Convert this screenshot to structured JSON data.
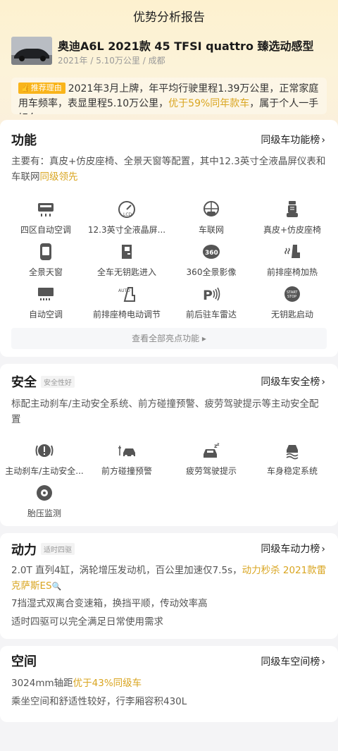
{
  "page_title": "优势分析报告",
  "car": {
    "name": "奥迪A6L 2021款 45 TFSI quattro 臻选动感型",
    "meta": "2021年 / 5.10万公里 / 成都"
  },
  "reason": {
    "tag": "推荐理由",
    "text_1": "2021年3月上牌，年平均行驶里程1.39万公里，正常家庭用车频率，表显里程5.10万公里，",
    "highlight": "优于59%同年款车",
    "text_2": "，属于个人一手好车"
  },
  "features": {
    "title": "功能",
    "link": "同级车功能榜",
    "desc_1": "主要有：真皮+仿皮座椅、全景天窗等配置，其中12.3英寸全液晶屏仪表和车联网",
    "desc_highlight": "同级领先",
    "items": [
      {
        "label": "四区自动空调",
        "icon": "climate-4zone-icon"
      },
      {
        "label": "12.3英寸全液晶屏...",
        "icon": "lcd-gauge-icon"
      },
      {
        "label": "车联网",
        "icon": "connected-car-icon"
      },
      {
        "label": "真皮+仿皮座椅",
        "icon": "leather-seat-icon"
      },
      {
        "label": "全景天窗",
        "icon": "panoramic-sunroof-icon"
      },
      {
        "label": "全车无钥匙进入",
        "icon": "keyless-entry-icon"
      },
      {
        "label": "360全景影像",
        "icon": "camera-360-icon"
      },
      {
        "label": "前排座椅加热",
        "icon": "seat-heating-icon"
      },
      {
        "label": "自动空调",
        "icon": "auto-ac-icon"
      },
      {
        "label": "前排座椅电动调节",
        "icon": "power-seat-icon"
      },
      {
        "label": "前后驻车雷达",
        "icon": "parking-radar-icon"
      },
      {
        "label": "无钥匙启动",
        "icon": "keyless-start-icon"
      }
    ],
    "all_button": "查看全部亮点功能 ▸"
  },
  "safety": {
    "title": "安全",
    "badge": "安全性好",
    "link": "同级车安全榜",
    "desc": "标配主动刹车/主动安全系统、前方碰撞预警、疲劳驾驶提示等主动安全配置",
    "items": [
      {
        "label": "主动刹车/主动安全...",
        "icon": "brake-warning-icon"
      },
      {
        "label": "前方碰撞预警",
        "icon": "collision-warning-icon"
      },
      {
        "label": "疲劳驾驶提示",
        "icon": "fatigue-alert-icon"
      },
      {
        "label": "车身稳定系统",
        "icon": "stability-control-icon"
      },
      {
        "label": "胎压监测",
        "icon": "tire-pressure-icon"
      }
    ]
  },
  "power": {
    "title": "动力",
    "badge": "适时四驱",
    "link": "同级车动力榜",
    "line1_a": "2.0T 直列4缸，涡轮增压发动机，百公里加速仅7.5s，",
    "line1_highlight": "动力秒杀 2021款雷克萨斯ES",
    "line2": "7挡湿式双离合变速箱，换挡平顺，传动效率高",
    "line3": "适时四驱可以完全满足日常使用需求"
  },
  "space": {
    "title": "空间",
    "link": "同级车空间榜",
    "line1_a": "3024mm轴距",
    "line1_highlight": "优于43%同级车",
    "line2": "乘坐空间和舒适性较好，行李厢容积430L"
  },
  "colors": {
    "accent": "#d9a520",
    "tag_bg": "#f9b41a",
    "hero_bg": "#fdf1cf"
  }
}
